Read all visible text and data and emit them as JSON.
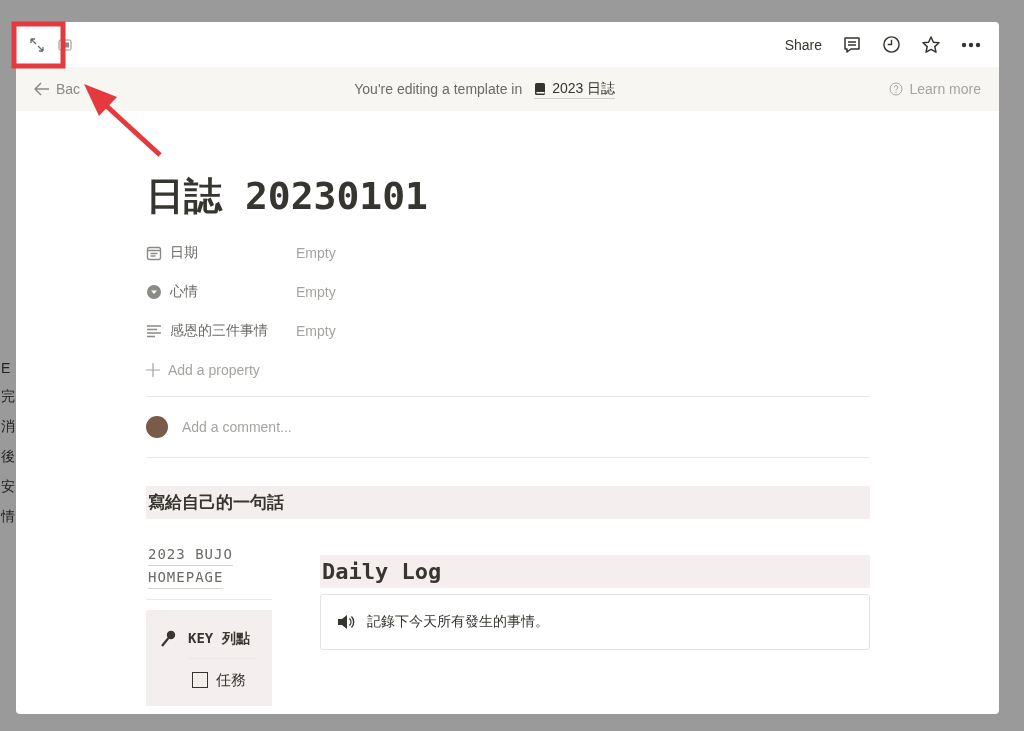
{
  "background": {
    "fragments": [
      "E",
      "完",
      "消",
      "後",
      "安",
      "情"
    ]
  },
  "topbar": {
    "share": "Share"
  },
  "banner": {
    "back": "Bac",
    "message": "You're editing a template in",
    "database": "2023 日誌",
    "learn_more": "Learn more"
  },
  "page": {
    "title": "日誌 20230101",
    "properties": [
      {
        "kind": "date",
        "name": "日期",
        "value": "Empty"
      },
      {
        "kind": "select",
        "name": "心情",
        "value": "Empty"
      },
      {
        "kind": "text",
        "name": "感恩的三件事情",
        "value": "Empty"
      }
    ],
    "add_property": "Add a property",
    "comment_placeholder": "Add a comment...",
    "heading": "寫給自己的一句話",
    "sidebar": {
      "link_lines": [
        "2023 BUJO",
        "HOMEPAGE"
      ],
      "key_title": "KEY 列點",
      "items": [
        {
          "label": "任務",
          "checked": false
        }
      ]
    },
    "daily_log": {
      "heading": "Daily Log",
      "callout": "記錄下今天所有發生的事情。"
    }
  }
}
